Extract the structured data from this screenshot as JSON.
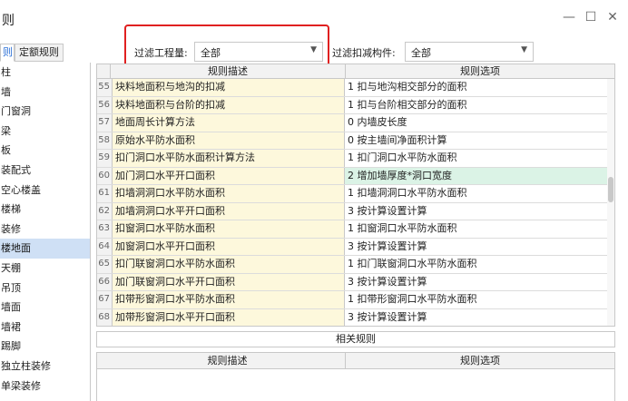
{
  "window": {
    "title": "则",
    "minimize": "—",
    "maximize": "☐",
    "close": "✕"
  },
  "tabs": [
    {
      "label": "则",
      "active": true
    },
    {
      "label": "定额规则",
      "active": false
    }
  ],
  "filters": {
    "project_label": "过滤工程量:",
    "project_value": "全部",
    "deduct_label": "过滤扣减构件:",
    "deduct_value": "全部"
  },
  "sidebar": {
    "items": [
      "柱",
      "墙",
      "门窗洞",
      "梁",
      "板",
      "装配式",
      "空心楼盖",
      "楼梯",
      "装修",
      "楼地面",
      "天棚",
      "吊顶",
      "墙面",
      "墙裙",
      "踢脚",
      "独立柱装修",
      "单梁装修"
    ],
    "selected": "楼地面"
  },
  "grid": {
    "header_desc": "规则描述",
    "header_opt": "规则选项",
    "rows": [
      {
        "num": "55",
        "desc": "块料地面积与地沟的扣减",
        "opt": "1 扣与地沟相交部分的面积"
      },
      {
        "num": "56",
        "desc": "块料地面积与台阶的扣减",
        "opt": "1 扣与台阶相交部分的面积"
      },
      {
        "num": "57",
        "desc": "地面周长计算方法",
        "opt": "0 内墙皮长度"
      },
      {
        "num": "58",
        "desc": "原始水平防水面积",
        "opt": "0 按主墙间净面积计算"
      },
      {
        "num": "59",
        "desc": "扣门洞口水平防水面积计算方法",
        "opt": "1 扣门洞口水平防水面积"
      },
      {
        "num": "60",
        "desc": "加门洞口水平开口面积",
        "opt": "2 增加墙厚度*洞口宽度",
        "selected": true
      },
      {
        "num": "61",
        "desc": "扣墙洞洞口水平防水面积",
        "opt": "1 扣墙洞洞口水平防水面积"
      },
      {
        "num": "62",
        "desc": "加墙洞洞口水平开口面积",
        "opt": "3 按计算设置计算"
      },
      {
        "num": "63",
        "desc": "扣窗洞口水平防水面积",
        "opt": "1 扣窗洞口水平防水面积"
      },
      {
        "num": "64",
        "desc": "加窗洞口水平开口面积",
        "opt": "3 按计算设置计算"
      },
      {
        "num": "65",
        "desc": "扣门联窗洞口水平防水面积",
        "opt": "1 扣门联窗洞口水平防水面积"
      },
      {
        "num": "66",
        "desc": "加门联窗洞口水平开口面积",
        "opt": "3 按计算设置计算"
      },
      {
        "num": "67",
        "desc": "扣带形窗洞口水平防水面积",
        "opt": "1 扣带形窗洞口水平防水面积"
      },
      {
        "num": "68",
        "desc": "加带形窗洞口水平开口面积",
        "opt": "3 按计算设置计算"
      }
    ]
  },
  "related": {
    "title": "相关规则",
    "header_desc": "规则描述",
    "header_opt": "规则选项"
  },
  "colors": {
    "highlight_border": "#e02020",
    "accent": "#2a6fd6",
    "desc_bg": "#fdf8dc",
    "selected_row": "#dbf3e6",
    "sidebar_selected": "#cfe0f5"
  }
}
